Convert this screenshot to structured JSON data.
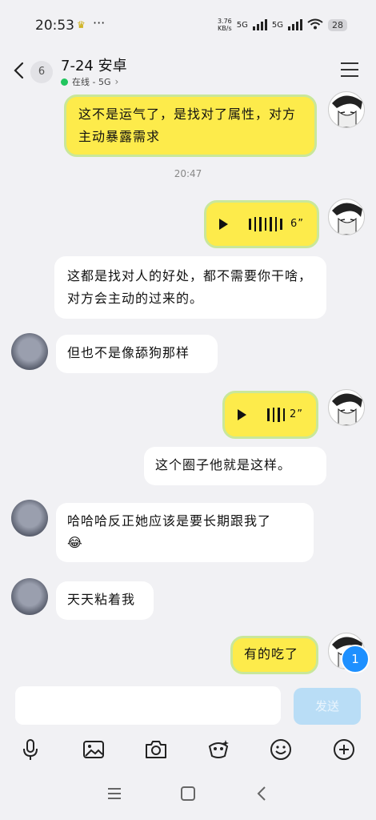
{
  "status_bar": {
    "time": "20:53",
    "speed_value": "3.76",
    "speed_unit": "KB/s",
    "net1": "5G",
    "net2": "5G",
    "battery": "28"
  },
  "header": {
    "back_count": "6",
    "title": "7-24 安卓",
    "status": "在线 - 5G"
  },
  "messages": [
    {
      "from": "me",
      "type": "text",
      "text": "这不是运气了，是找对了属性，对方主动暴露需求"
    },
    {
      "type": "timestamp",
      "text": "20:47"
    },
    {
      "from": "me",
      "type": "voice",
      "duration": "6”"
    },
    {
      "from": "other",
      "type": "text",
      "text": "这都是找对人的好处，都不需要你干啥，对方会主动的过来的。"
    },
    {
      "from": "other",
      "type": "text",
      "text": "但也不是像舔狗那样"
    },
    {
      "from": "me",
      "type": "voice",
      "duration": "2”"
    },
    {
      "from": "other",
      "type": "text",
      "text": "这个圈子他就是这样。"
    },
    {
      "from": "other",
      "type": "text",
      "text": "哈哈哈反正她应该是要长期跟我了",
      "emoji": "😂"
    },
    {
      "from": "other",
      "type": "text",
      "text": "天天粘着我"
    },
    {
      "from": "me",
      "type": "text",
      "text": "有的吃了"
    }
  ],
  "unread_count": "1",
  "input": {
    "send_label": "发送"
  },
  "toolbar_icons": [
    "microphone-icon",
    "image-icon",
    "camera-icon",
    "red-packet-icon",
    "emoji-icon",
    "plus-icon"
  ],
  "nav_icons": [
    "menu-icon",
    "home-icon",
    "back-icon"
  ],
  "colors": {
    "my_bubble": "#fdeb4b",
    "my_bubble_border": "#c9e79a",
    "send_button": "#b9ddf6",
    "online": "#22c55e",
    "unread_badge": "#1e90ff"
  }
}
